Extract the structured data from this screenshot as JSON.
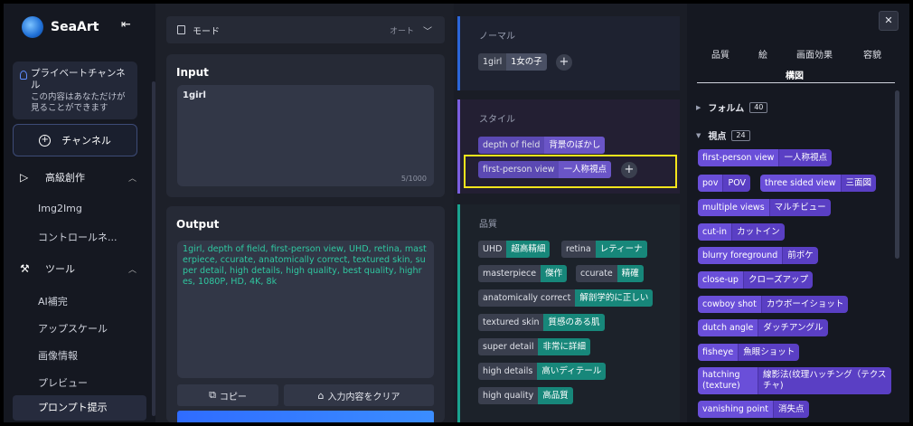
{
  "sidebar": {
    "brand": "SeaArt",
    "collapse_icon": "collapse-left-icon",
    "private_channel": {
      "title": "プライベートチャンネル",
      "desc": "この内容はあなただけが見ることができます"
    },
    "channel_button": "チャンネル",
    "sections": [
      {
        "label": "高級創作",
        "icon": "play-icon"
      },
      {
        "label": "ツール",
        "icon": "wrench-icon"
      }
    ],
    "creative_items": [
      "Img2Img",
      "コントロールネ..."
    ],
    "tool_items": [
      "AI補完",
      "アップスケール",
      "画像情報",
      "プレビュー",
      "プロンプト提示"
    ]
  },
  "main": {
    "mode_label": "モード",
    "mode_value": "オート",
    "input": {
      "title": "Input",
      "value": "1girl",
      "counter": "5/1000"
    },
    "output": {
      "title": "Output",
      "value": "1girl, depth of field, first-person view, UHD, retina, masterpiece, ccurate, anatomically correct, textured skin, super detail, high details, high quality, best quality, highres, 1080P, HD, 4K, 8k"
    },
    "copy_button": "コピー",
    "clear_button": "入力内容をクリア"
  },
  "middle": {
    "normal": {
      "label": "ノーマル",
      "tags": [
        {
          "en": "1girl",
          "jp": "1女の子"
        }
      ]
    },
    "style": {
      "label": "スタイル",
      "tags": [
        {
          "en": "depth of field",
          "jp": "背景のぼかし"
        },
        {
          "en": "first-person view",
          "jp": "一人称視点"
        }
      ]
    },
    "quality": {
      "label": "品質",
      "tags": [
        {
          "en": "UHD",
          "jp": "超高精細"
        },
        {
          "en": "retina",
          "jp": "レティーナ"
        },
        {
          "en": "masterpiece",
          "jp": "傑作"
        },
        {
          "en": "ccurate",
          "jp": "精確"
        },
        {
          "en": "anatomically correct",
          "jp": "解剖学的に正しい"
        },
        {
          "en": "textured skin",
          "jp": "質感のある肌"
        },
        {
          "en": "super detail",
          "jp": "非常に詳細"
        },
        {
          "en": "high details",
          "jp": "高いディテール"
        },
        {
          "en": "high quality",
          "jp": "高品質"
        }
      ]
    }
  },
  "right": {
    "tabs": [
      "品質",
      "絵",
      "画面効果",
      "容貌",
      "構図"
    ],
    "selected_tab": "構図",
    "categories": [
      {
        "label": "フォルム",
        "count": "40"
      },
      {
        "label": "視点",
        "count": "24"
      }
    ],
    "tags": [
      {
        "en": "first-person view",
        "jp": "一人称視点"
      },
      {
        "en": "pov",
        "jp": "POV"
      },
      {
        "en": "three sided view",
        "jp": "三面図"
      },
      {
        "en": "multiple views",
        "jp": "マルチビュー"
      },
      {
        "en": "cut-in",
        "jp": "カットイン"
      },
      {
        "en": "blurry foreground",
        "jp": "前ボケ"
      },
      {
        "en": "close-up",
        "jp": "クローズアップ"
      },
      {
        "en": "cowboy shot",
        "jp": "カウボーイショット"
      },
      {
        "en": "dutch angle",
        "jp": "ダッチアングル"
      },
      {
        "en": "fisheye",
        "jp": "魚眼ショット"
      },
      {
        "en": "hatching (texture)",
        "jp": "線影法(纹理ハッチング（テクスチャ)"
      },
      {
        "en": "vanishing point",
        "jp": "消失点"
      }
    ]
  },
  "colors": {
    "accent": "#6a55c7",
    "teal": "#17877a",
    "highlight": "#f6e51c",
    "output_text": "#2fc7a0"
  }
}
